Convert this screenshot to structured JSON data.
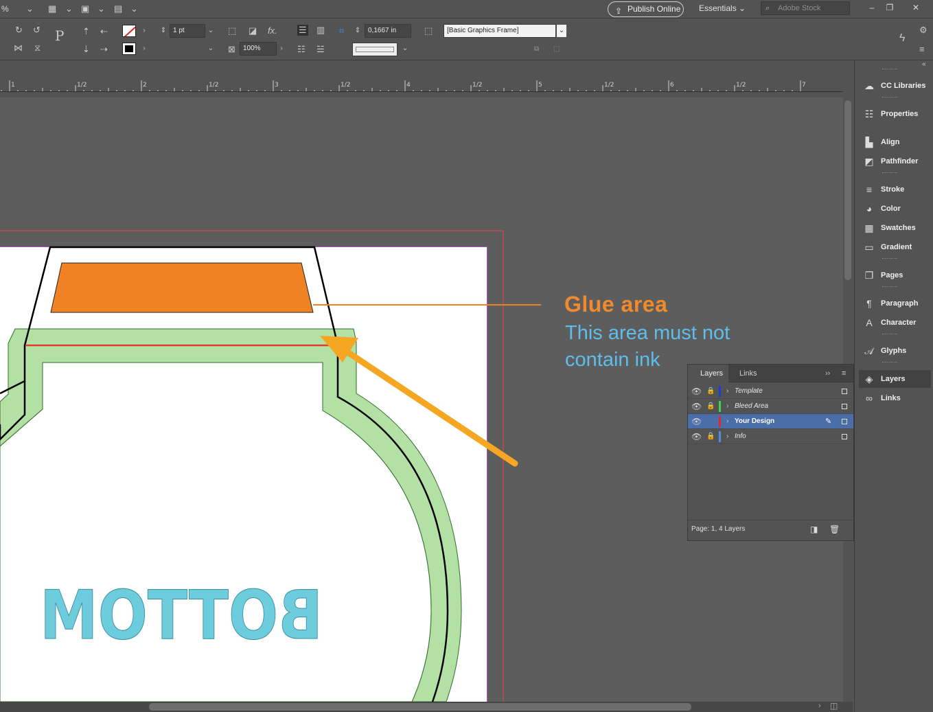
{
  "appbar": {
    "zoom_value": "%",
    "publish_label": "Publish Online",
    "workspace_label": "Essentials",
    "stock_placeholder": "Adobe Stock"
  },
  "control": {
    "stroke_weight": "1 pt",
    "opacity": "100%",
    "corner_size": "0,1667 in",
    "object_style": "[Basic Graphics Frame]"
  },
  "ruler": {
    "labels": [
      "1",
      "1/2",
      "2",
      "1/2",
      "3",
      "1/2",
      "4",
      "1/2",
      "5",
      "1/2",
      "6",
      "1/2",
      "7"
    ]
  },
  "artwork": {
    "bottom_text": "BOTTOM",
    "colors": {
      "glue": "#f08224",
      "green_band": "#b3e0a4",
      "cyan_text": "#6ecddd",
      "arrow": "#f5a623",
      "bleed_line": "#e8484e",
      "red_line": "#e43b2c"
    }
  },
  "annotation": {
    "title": "Glue area",
    "line1": "This area must not",
    "line2": "contain ink"
  },
  "layers_panel": {
    "tabs": [
      "Layers",
      "Links"
    ],
    "layers": [
      {
        "name": "Template",
        "color": "#1f3bd6",
        "locked": true,
        "selected": false
      },
      {
        "name": "Bleed Area",
        "color": "#3fd44a",
        "locked": true,
        "selected": false
      },
      {
        "name": "Your Design",
        "color": "#e02a2a",
        "locked": false,
        "selected": true
      },
      {
        "name": "Info",
        "color": "#4a90e2",
        "locked": true,
        "selected": false
      }
    ],
    "footer": "Page: 1, 4 Layers"
  },
  "dock": {
    "items": [
      {
        "label": "CC Libraries",
        "icon": "cc-libraries-icon"
      },
      {
        "label": "Properties",
        "icon": "properties-icon"
      },
      {
        "label": "Align",
        "icon": "align-icon"
      },
      {
        "label": "Pathfinder",
        "icon": "pathfinder-icon"
      },
      {
        "label": "Stroke",
        "icon": "stroke-icon"
      },
      {
        "label": "Color",
        "icon": "color-icon"
      },
      {
        "label": "Swatches",
        "icon": "swatches-icon"
      },
      {
        "label": "Gradient",
        "icon": "gradient-icon"
      },
      {
        "label": "Pages",
        "icon": "pages-icon"
      },
      {
        "label": "Paragraph",
        "icon": "paragraph-icon"
      },
      {
        "label": "Character",
        "icon": "character-icon"
      },
      {
        "label": "Glyphs",
        "icon": "glyphs-icon"
      },
      {
        "label": "Layers",
        "icon": "layers-icon"
      },
      {
        "label": "Links",
        "icon": "links-icon"
      }
    ]
  }
}
